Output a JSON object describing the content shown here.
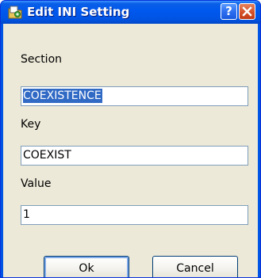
{
  "window": {
    "title": "Edit INI Setting",
    "help_glyph": "?",
    "icons": {
      "app": "ini-file-icon",
      "help": "help-icon",
      "close": "close-icon"
    }
  },
  "form": {
    "section_label": "Section",
    "section_value": "COEXISTENCE",
    "key_label": "Key",
    "key_value": "COEXIST",
    "value_label": "Value",
    "value_value": "1"
  },
  "buttons": {
    "ok_label": "Ok",
    "cancel_label": "Cancel"
  },
  "colors": {
    "titlebar": "#0054e3",
    "client_bg": "#ece9d8",
    "selection": "#316ac5",
    "field_border": "#7f9db9",
    "close_button": "#d45129"
  }
}
